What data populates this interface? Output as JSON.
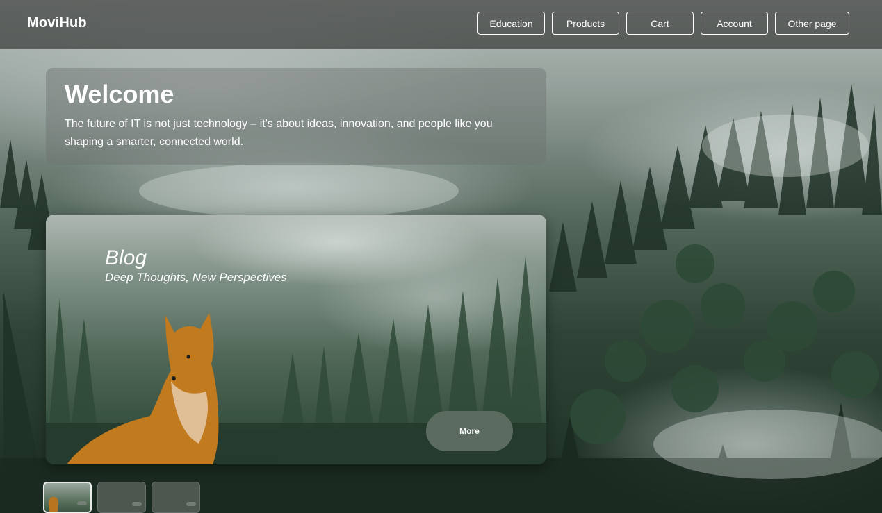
{
  "app": {
    "brand": "MoviHub"
  },
  "nav": {
    "items": [
      {
        "label": "Education"
      },
      {
        "label": "Products"
      },
      {
        "label": "Cart"
      },
      {
        "label": "Account"
      },
      {
        "label": "Other page"
      }
    ]
  },
  "welcome": {
    "title": "Welcome",
    "text": "The future of IT is not just technology – it's about ideas, innovation, and people like you shaping a smarter, connected world."
  },
  "blog_card": {
    "title": "Blog",
    "subtitle": "Deep Thoughts, New Perspectives",
    "button_label": "More"
  },
  "carousel": {
    "slides": 3,
    "active_index": 0
  },
  "colors": {
    "navbar_bg": "#2a2c2a",
    "more_button": "#5c6b60",
    "fox": "#c27a1f"
  }
}
